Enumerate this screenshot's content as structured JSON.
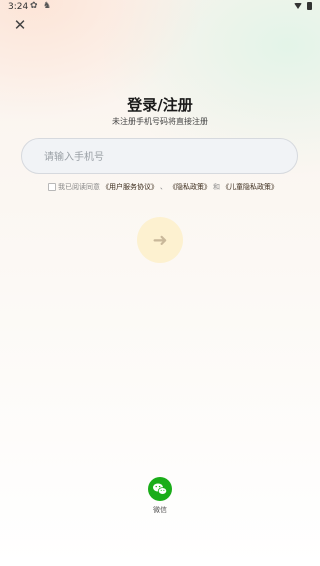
{
  "status_bar": {
    "time": "3:24"
  },
  "header": {
    "close_icon": "close-icon",
    "title": "登录/注册",
    "subtitle": "未注册手机号码将直接注册"
  },
  "form": {
    "phone_placeholder": "请输入手机号",
    "phone_value": ""
  },
  "agreement": {
    "prefix": "我已阅读同意",
    "user_agreement": "《用户服务协议》",
    "sep1": "、",
    "privacy_policy": "《隐私政策》",
    "sep2": "和",
    "child_privacy": "《儿童隐私政策》",
    "checked": false
  },
  "submit": {
    "icon": "arrow-right-icon",
    "bg_color": "#fdf1d0"
  },
  "third_party": {
    "wechat_label": "微信",
    "wechat_color": "#1aad19"
  }
}
